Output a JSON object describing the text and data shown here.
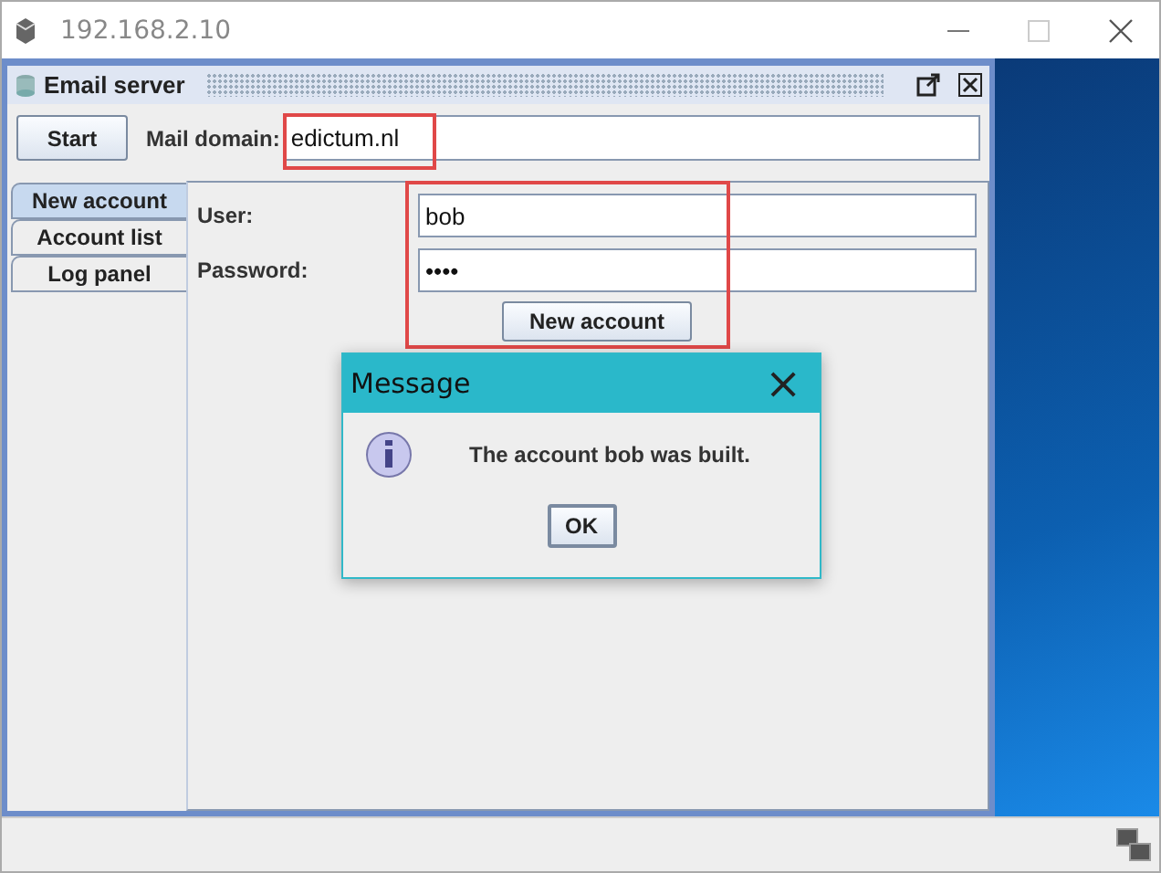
{
  "window": {
    "title": "192.168.2.10"
  },
  "frame": {
    "title": "Email server"
  },
  "toolbar": {
    "start_button": "Start",
    "domain_label": "Mail domain:",
    "domain_value": "edictum.nl"
  },
  "tabs": [
    {
      "label": "New account",
      "selected": true
    },
    {
      "label": "Account list",
      "selected": false
    },
    {
      "label": "Log panel",
      "selected": false
    }
  ],
  "form": {
    "fields": [
      {
        "label": "User:",
        "value": "bob"
      },
      {
        "label": "Password:",
        "value": "••••"
      }
    ],
    "button": "New account"
  },
  "dialog": {
    "title": "Message",
    "close": "×",
    "message": "The account bob was built.",
    "button": "OK"
  }
}
